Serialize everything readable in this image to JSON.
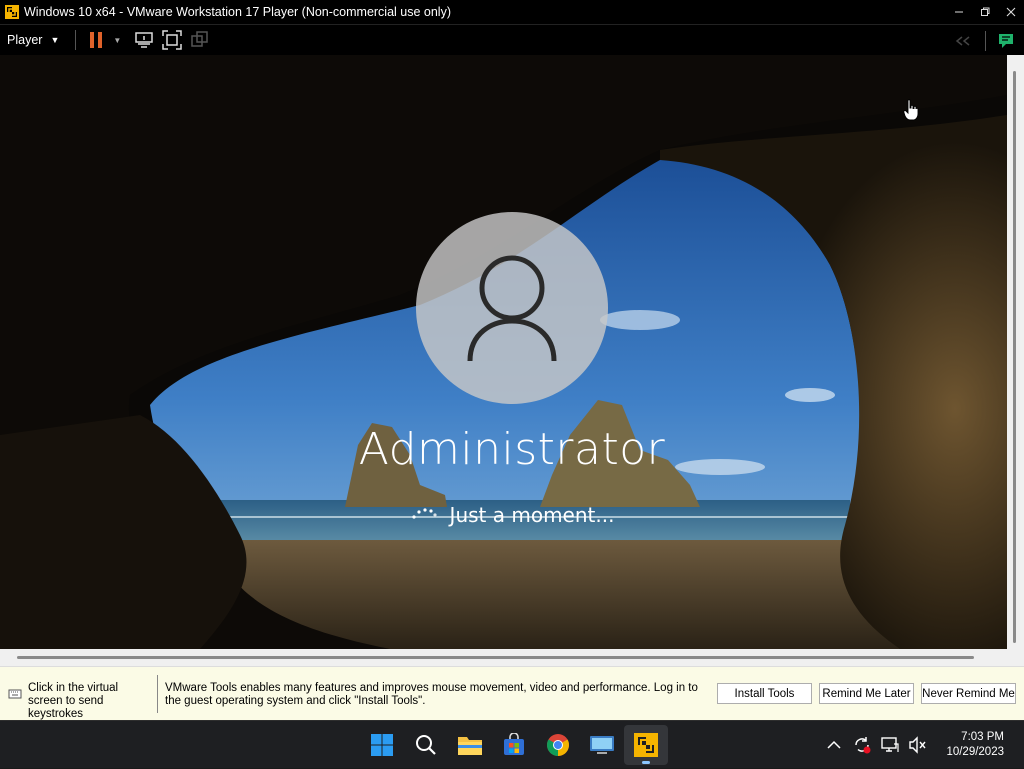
{
  "window": {
    "title": "Windows 10 x64 - VMware Workstation 17 Player (Non-commercial use only)",
    "controls": [
      "minimize",
      "maximize",
      "close"
    ]
  },
  "toolbar": {
    "player_label": "Player",
    "buttons": [
      "pause-icon",
      "send-ctrl-alt-del-icon",
      "fit-guest-icon",
      "unity-icon"
    ]
  },
  "login": {
    "username": "Administrator",
    "status": "Just a moment..."
  },
  "tools_bar": {
    "hint": "Click in the virtual screen to send keystrokes",
    "message": "VMware Tools enables many features and improves mouse movement, video and performance. Log in to the guest operating system and click \"Install Tools\".",
    "install_label": "Install Tools",
    "remind_label": "Remind Me Later",
    "never_label": "Never Remind Me"
  },
  "taskbar": {
    "apps": [
      "windows-start-icon",
      "search-icon",
      "file-explorer-icon",
      "microsoft-store-icon",
      "chrome-icon",
      "remote-desktop-icon",
      "vmware-player-icon"
    ],
    "active_app": "vmware-player-icon",
    "time": "7:03 PM",
    "date": "10/29/2023"
  },
  "colors": {
    "accent": "#8bc6ff",
    "tools_bar_bg": "#fbfbe6",
    "vmware_orange": "#f59c1a"
  }
}
